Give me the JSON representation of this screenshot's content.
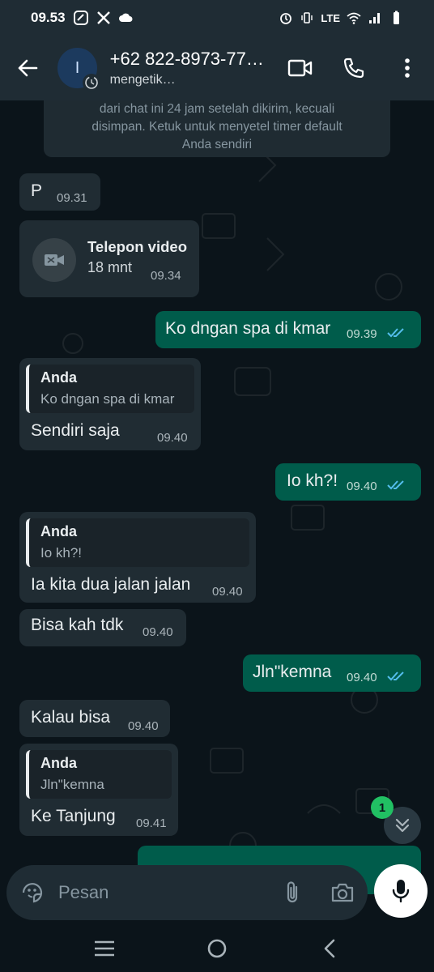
{
  "status_bar": {
    "time": "09.53",
    "network_label": "LTE"
  },
  "header": {
    "avatar_letter": "I",
    "name": "+62 822-8973-77…",
    "subtitle": "mengetik…"
  },
  "system_note": {
    "line1": "dari chat ini 24 jam setelah dikirim, kecuali",
    "line2": "disimpan. Ketuk untuk menyetel timer default",
    "line3": "Anda sendiri"
  },
  "messages": [
    {
      "text": "P",
      "time": "09.31"
    },
    {
      "call_title": "Telepon video",
      "call_duration": "18 mnt",
      "time": "09.34"
    },
    {
      "text": "Ko dngan spa di kmar",
      "time": "09.39"
    },
    {
      "quote_name": "Anda",
      "quote_text": "Ko dngan spa di kmar",
      "text": "Sendiri saja",
      "time": "09.40"
    },
    {
      "text": "Io kh?!",
      "time": "09.40"
    },
    {
      "quote_name": "Anda",
      "quote_text": "Io kh?!",
      "text": "Ia kita dua jalan jalan",
      "time": "09.40"
    },
    {
      "text": "Bisa kah tdk",
      "time": "09.40"
    },
    {
      "text": "Jln\"kemna",
      "time": "09.40"
    },
    {
      "text": "Kalau bisa",
      "time": "09.40"
    },
    {
      "quote_name": "Anda",
      "quote_text": "Jln\"kemna",
      "text": "Ke Tanjung",
      "time": "09.41"
    }
  ],
  "scroll": {
    "unread_count": "1"
  },
  "composer": {
    "placeholder": "Pesan"
  },
  "colors": {
    "incoming": "#202c33",
    "outgoing": "#005c4b",
    "read_ticks": "#53bdeb",
    "badge": "#21c063"
  }
}
